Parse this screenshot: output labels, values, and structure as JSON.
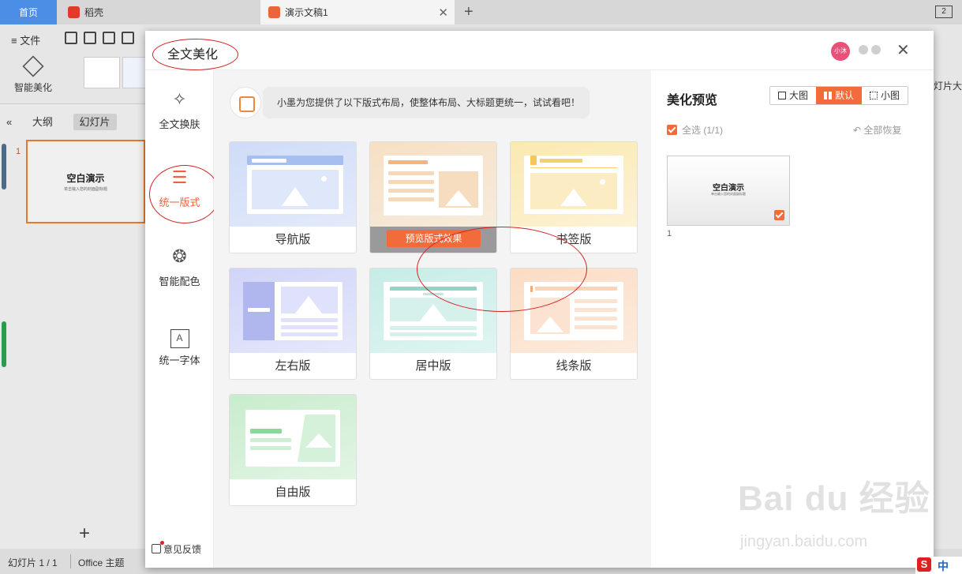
{
  "app": {
    "tabs": [
      {
        "label": "首页"
      },
      {
        "label": "稻壳"
      },
      {
        "label": "演示文稿1"
      }
    ],
    "new_tab": "+",
    "window_btn": "2",
    "menu_file": "≡ 文件",
    "smart_beautify": "智能美化",
    "right_strip_text": "灯片大小",
    "view_tabs": [
      "大纲",
      "幻灯片"
    ],
    "collapse": "«",
    "slide_number": "1",
    "slide_title": "空白演示",
    "slide_subtitle": "单击输入您的封面副标题",
    "add_slide": "+",
    "status_slide": "幻灯片 1 / 1",
    "status_theme": "Office 主题",
    "ime_label": "中",
    "colors": {
      "accent": "#f26b3a",
      "home_tab": "#4a8ee6",
      "annotation": "#d42020"
    }
  },
  "dialog": {
    "title": "全文美化",
    "avatar": "小沐",
    "close_icon": "close-icon",
    "nav": [
      {
        "label": "全文换肤",
        "icon": "magic-wand-icon"
      },
      {
        "label": "统一版式",
        "icon": "layout-icon"
      },
      {
        "label": "智能配色",
        "icon": "color-circles-icon"
      },
      {
        "label": "统一字体",
        "icon": "font-icon"
      }
    ],
    "feedback": "意见反馈",
    "assistant_text": "小墨为您提供了以下版式布局，使整体布局、大标题更统一，试试看吧！",
    "layouts": [
      {
        "label": "导航版"
      },
      {
        "label": "居中版",
        "overlay": "预览版式效果"
      },
      {
        "label": "书签版"
      },
      {
        "label": "左右版"
      },
      {
        "label": "居中版"
      },
      {
        "label": "线条版"
      },
      {
        "label": "自由版"
      }
    ],
    "preview": {
      "title": "美化预览",
      "sizes": [
        "大图",
        "默认",
        "小图"
      ],
      "active_size": "默认",
      "select_all": "全选 (1/1)",
      "restore_all": "全部恢复",
      "thumb_title": "空白演示",
      "thumb_subtitle": "单击输入您的封面副标题",
      "thumb_number": "1"
    }
  },
  "watermark": {
    "main": "Bai du 经验",
    "sub": "jingyan.baidu.com"
  }
}
